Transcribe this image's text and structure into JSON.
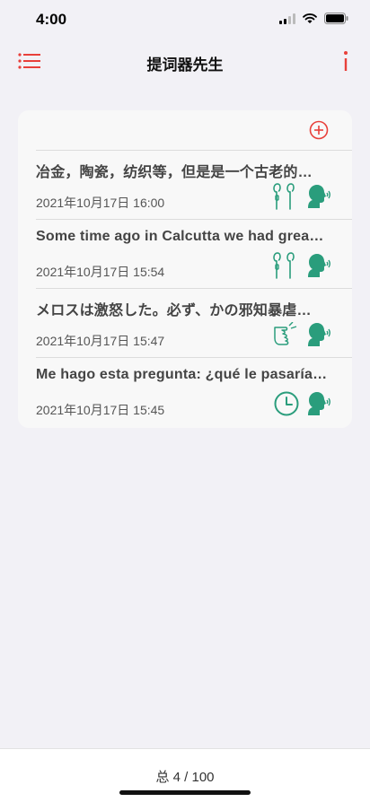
{
  "status": {
    "time": "4:00"
  },
  "nav": {
    "title": "提词器先生",
    "menu_icon": "list-icon",
    "info_icon": "info-icon"
  },
  "card": {
    "add_icon": "plus-circle-icon"
  },
  "items": [
    {
      "title": "冶金，陶瓷，纺织等，但是是一个古老的…",
      "date": "2021年10月17日 16:00",
      "mode_icon": "earphones-icon",
      "voice_icon": "speaking-head-icon"
    },
    {
      "title": "Some time ago in Calcutta we had grea…",
      "date": "2021年10月17日 15:54",
      "mode_icon": "earphones-icon",
      "voice_icon": "speaking-head-icon"
    },
    {
      "title": "メロスは激怒した。必ず、かの邪知暴虐…",
      "date": "2021年10月17日 15:47",
      "mode_icon": "hand-pointer-icon",
      "voice_icon": "speaking-head-icon"
    },
    {
      "title": "Me hago esta pregunta: ¿qué le pasaría…",
      "date": "2021年10月17日 15:45",
      "mode_icon": "clock-icon",
      "voice_icon": "speaking-head-icon"
    }
  ],
  "footer": {
    "count": "总 4 / 100"
  },
  "colors": {
    "accent_red": "#e8403a",
    "icon_green": "#2a9d7c",
    "background": "#f2f1f6"
  }
}
